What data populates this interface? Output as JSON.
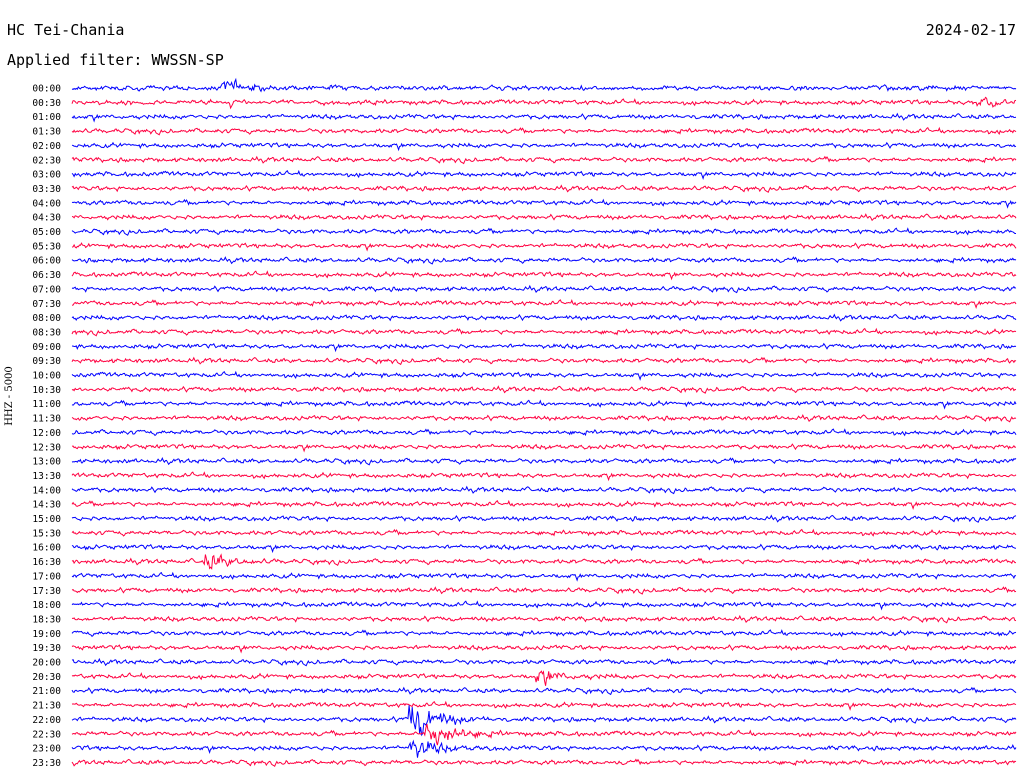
{
  "header": {
    "station": "HC Tei-Chania",
    "date": "2024-02-17",
    "filter": "Applied filter: WWSSN-SP"
  },
  "chart_data": {
    "type": "line",
    "ylabel": "HHZ - 5000",
    "row_labels": [
      "00:00",
      "00:30",
      "01:00",
      "01:30",
      "02:00",
      "02:30",
      "03:00",
      "03:30",
      "04:00",
      "04:30",
      "05:00",
      "05:30",
      "06:00",
      "06:30",
      "07:00",
      "07:30",
      "08:00",
      "08:30",
      "09:00",
      "09:30",
      "10:00",
      "10:30",
      "11:00",
      "11:30",
      "12:00",
      "12:30",
      "13:00",
      "13:30",
      "14:00",
      "14:30",
      "15:00",
      "15:30",
      "16:00",
      "16:30",
      "17:00",
      "17:30",
      "18:00",
      "18:30",
      "19:00",
      "19:30",
      "20:00",
      "20:30",
      "21:00",
      "21:30",
      "22:00",
      "22:30",
      "23:00",
      "23:30"
    ],
    "trace_colors": [
      "#0000ff",
      "#ff0040"
    ],
    "events": [
      {
        "row": 44,
        "minute": 11.0,
        "amplitude": 4.5
      },
      {
        "row": 45,
        "minute": 11.5,
        "amplitude": 4.0
      },
      {
        "row": 46,
        "minute": 11.0,
        "amplitude": 2.2
      },
      {
        "row": 33,
        "minute": 4.5,
        "amplitude": 1.6
      },
      {
        "row": 41,
        "minute": 15.0,
        "amplitude": 1.4
      },
      {
        "row": 0,
        "minute": 5.0,
        "amplitude": 1.5
      },
      {
        "row": 1,
        "minute": 29.0,
        "amplitude": 1.3
      }
    ]
  }
}
